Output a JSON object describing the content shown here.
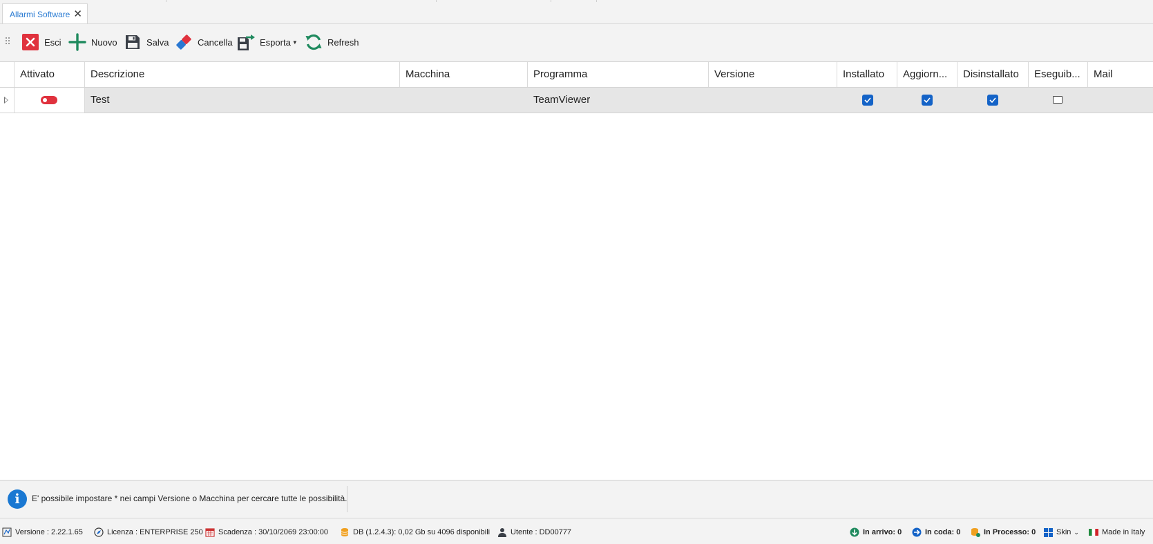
{
  "tabs": [
    {
      "label": "Allarmi Software",
      "close": "✕"
    }
  ],
  "toolbar": {
    "esci": "Esci",
    "nuovo": "Nuovo",
    "salva": "Salva",
    "cancella": "Cancella",
    "esporta": "Esporta",
    "refresh": "Refresh"
  },
  "grid": {
    "columns": [
      "Attivato",
      "Descrizione",
      "Macchina",
      "Programma",
      "Versione",
      "Installato",
      "Aggiorn...",
      "Disinstallato",
      "Eseguib...",
      "Mail"
    ],
    "rows": [
      {
        "attivato": false,
        "descrizione": "Test",
        "macchina": "",
        "programma": "TeamViewer",
        "versione": "",
        "installato": true,
        "aggiornato": true,
        "disinstallato": true,
        "eseguibile": false,
        "mail": ""
      }
    ]
  },
  "info": {
    "text": "E' possibile impostare * nei campi Versione o Macchina per cercare tutte le possibilità."
  },
  "status": {
    "versione": "Versione : 2.22.1.65",
    "licenza": "Licenza : ENTERPRISE 250",
    "scadenza": "Scadenza : 30/10/2069 23:00:00",
    "db": "DB (1.2.4.3): 0,02 Gb su 4096 disponibili",
    "utente": "Utente : DD00777",
    "in_arrivo": "In arrivo: 0",
    "in_coda": "In coda: 0",
    "in_processo": "In Processo: 0",
    "skin": "Skin",
    "made_in": "Made in Italy"
  },
  "colors": {
    "accent": "#1463c7",
    "tab_label": "#2a7bd2",
    "toggle_off": "#e0323e",
    "esci_red": "#e0323e",
    "nuovo_green": "#1f8a5e",
    "refresh_green": "#1f8a5e"
  }
}
